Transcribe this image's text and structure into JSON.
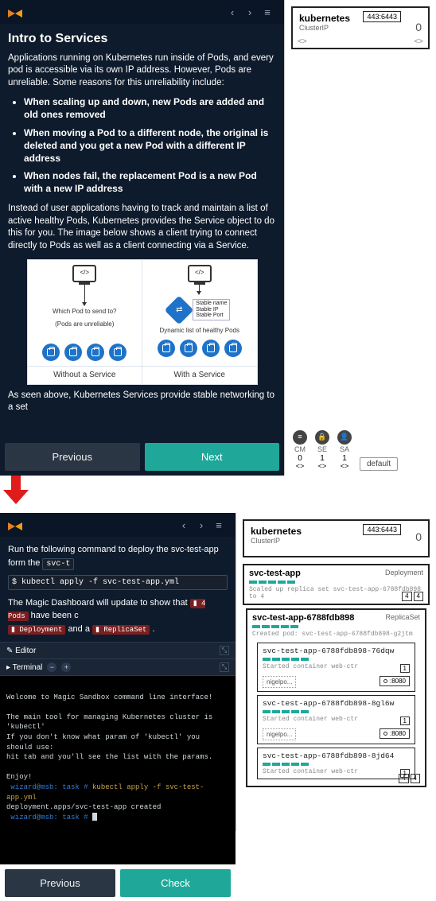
{
  "top": {
    "nav": {
      "prev": "‹",
      "next": "›",
      "menu": "≡"
    },
    "title": "Intro to Services",
    "p1": "Applications running on Kubernetes run inside of Pods, and every pod is accessible via its own IP address. However, Pods are unreliable. Some reasons for this unreliability include:",
    "bullets": [
      "When scaling up and down, new Pods are added and old ones removed",
      "When moving a Pod to a different node, the original is deleted and you get a new Pod with a different IP address",
      "When nodes fail, the replacement Pod is a new Pod with a new IP address"
    ],
    "p2": "Instead of user applications having to track and maintain a list of active healthy Pods, Kubernetes provides the Service object to do this for you. The image below shows a client trying to connect directly to Pods as well as a client connecting via a Service.",
    "diagram": {
      "client": "</>",
      "q": "Which Pod to send to?",
      "unreliable": "(Pods are unreliable)",
      "stable": "Stable name\nStable IP\nStable Port",
      "dynamic": "Dynamic list of healthy Pods",
      "left_label": "Without a Service",
      "right_label": "With a Service"
    },
    "p3": "As seen above, Kubernetes Services provide stable networking to a set",
    "buttons": {
      "prev": "Previous",
      "next": "Next"
    },
    "svc": {
      "name": "kubernetes",
      "type": "ClusterIP",
      "port": "443:6443",
      "count": "0"
    },
    "resources": [
      {
        "icon": "≡",
        "label": "CM",
        "count": "0",
        "caret": "<>"
      },
      {
        "icon": "🔒",
        "label": "SE",
        "count": "1",
        "caret": "<>"
      },
      {
        "icon": "👤",
        "label": "SA",
        "count": "1",
        "caret": "<>"
      }
    ],
    "ns": "default"
  },
  "bottom": {
    "nav": {
      "prev": "‹",
      "next": "›",
      "menu": "≡"
    },
    "p1_a": "Run the following command to deploy the svc-test-app form the ",
    "p1_b": "svc-t",
    "cmd": "$ kubectl apply -f svc-test-app.yml",
    "p2_a": "The Magic Dashboard will update to show that ",
    "p2_pods": "▮ 4 Pods",
    "p2_b": " have been c",
    "p2_dep": "▮ Deployment",
    "p2_c": " and a ",
    "p2_rs": "▮ ReplicaSet",
    "p2_d": ".",
    "editor_label": "✎ Editor",
    "terminal_label": "▸ Terminal",
    "terminal_lines": {
      "l1": "Welcome to Magic Sandbox command line interface!",
      "l2": "The main tool for managing Kubernetes cluster is 'kubectl'",
      "l3": "If you don't know what param of 'kubectl' you should use:",
      "l4": "hit tab and you'll see the list with the params.",
      "l5": "Enjoy!",
      "prompt1": " wizard@msb: task #",
      "cmd1": " kubectl apply -f svc-test-app.yml",
      "out1": "deployment.apps/svc-test-app created",
      "prompt2": " wizard@msb: task #"
    },
    "buttons": {
      "prev": "Previous",
      "check": "Check"
    },
    "svc": {
      "name": "kubernetes",
      "type": "ClusterIP",
      "port": "443:6443",
      "count": "0"
    },
    "dep": {
      "name": "svc-test-app",
      "kind": "Deployment",
      "log": "Scaled up replica set svc-test-app-6788fdb898 to 4",
      "a": "4",
      "b": "4"
    },
    "rs": {
      "name": "svc-test-app-6788fdb898",
      "kind": "ReplicaSet",
      "log": "Created pod: svc-test-app-6788fdb898-g2jtm",
      "a": "4",
      "b": "4"
    },
    "pods": [
      {
        "name": "svc-test-app-6788fdb898-76dqw",
        "status": "Started container web-ctr",
        "cnt": "1",
        "img": "nigelpo...",
        "port": ":8080"
      },
      {
        "name": "svc-test-app-6788fdb898-8gl6w",
        "status": "Started container web-ctr",
        "cnt": "1",
        "img": "nigelpo...",
        "port": ":8080"
      },
      {
        "name": "svc-test-app-6788fdb898-8jd64",
        "status": "Started container web-ctr",
        "cnt": "1"
      }
    ]
  }
}
